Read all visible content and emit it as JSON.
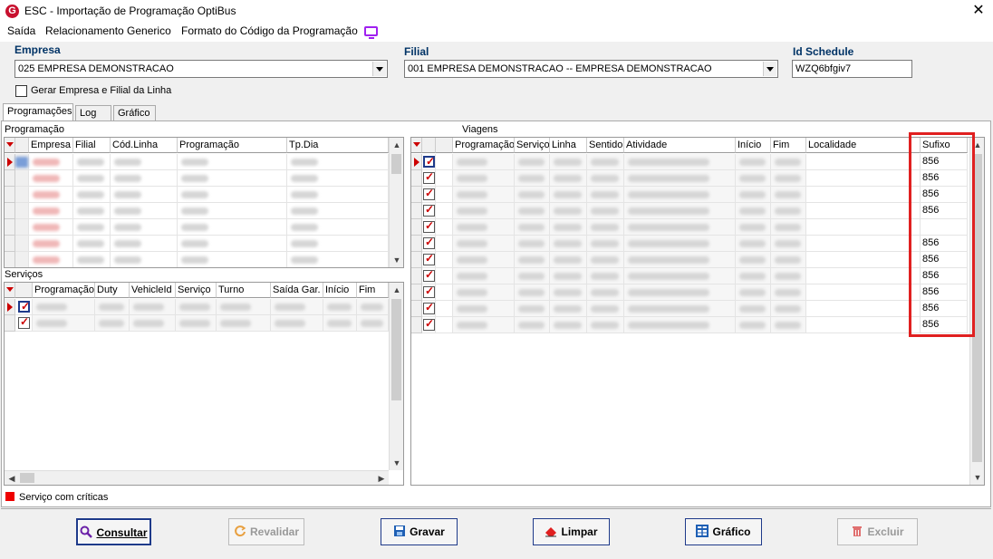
{
  "window": {
    "title": "ESC - Importação de Programação OptiBus"
  },
  "menu": [
    "Saída",
    "Relacionamento Generico",
    "Formato do Código da Programação"
  ],
  "filters": {
    "empresa_label": "Empresa",
    "empresa_value": "025 EMPRESA DEMONSTRACAO",
    "filial_label": "Filial",
    "filial_value": "001 EMPRESA DEMONSTRACAO -- EMPRESA DEMONSTRACAO",
    "schedule_label": "Id Schedule",
    "schedule_value": "WZQ6bfgiv7",
    "gerar_label": "Gerar Empresa e Filial da Linha"
  },
  "tabs": [
    "Programações",
    "Log",
    "Gráfico"
  ],
  "programacao": {
    "title": "Programação",
    "columns": [
      "Empresa",
      "Filial",
      "Cód.Linha",
      "Programação",
      "Tp.Dia"
    ]
  },
  "servicos": {
    "title": "Serviços",
    "columns": [
      "Programação",
      "Duty",
      "VehicleId",
      "Serviço",
      "Turno",
      "Saída Gar.",
      "Início",
      "Fim"
    ]
  },
  "viagens": {
    "title": "Viagens",
    "columns": [
      "Programação",
      "Serviço",
      "Linha",
      "Sentido",
      "Atividade",
      "Início",
      "Fim",
      "Localidade",
      "Sufixo"
    ],
    "sufixos": [
      "856",
      "856",
      "856",
      "856",
      "",
      "856",
      "856",
      "856",
      "856",
      "856",
      "856"
    ]
  },
  "legend": {
    "text": "Serviço com críticas",
    "color": "#e00000"
  },
  "buttons": {
    "consultar": "Consultar",
    "revalidar": "Revalidar",
    "gravar": "Gravar",
    "limpar": "Limpar",
    "grafico": "Gráfico",
    "excluir": "Excluir"
  }
}
